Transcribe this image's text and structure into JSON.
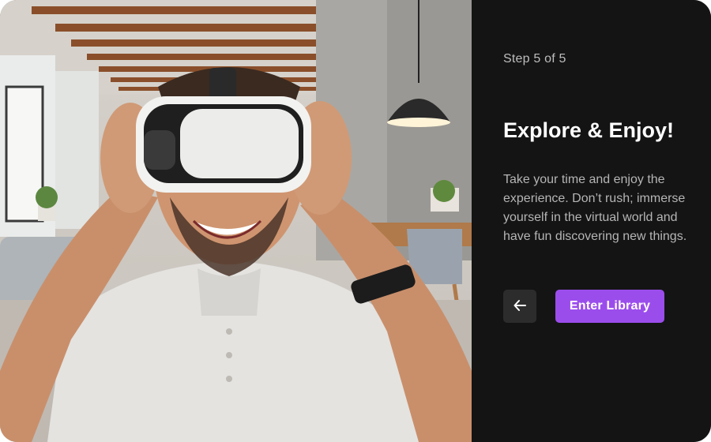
{
  "step": {
    "label": "Step 5 of 5"
  },
  "content": {
    "title": "Explore & Enjoy!",
    "description": "Take your time and enjoy the experience. Don’t rush; immerse yourself in the virtual world and have fun discovering new things."
  },
  "actions": {
    "back_icon": "arrow-left-icon",
    "primary_label": "Enter Library"
  },
  "colors": {
    "panel_background": "#141414",
    "accent": "#9b4dec",
    "back_button": "#2c2c2c"
  }
}
